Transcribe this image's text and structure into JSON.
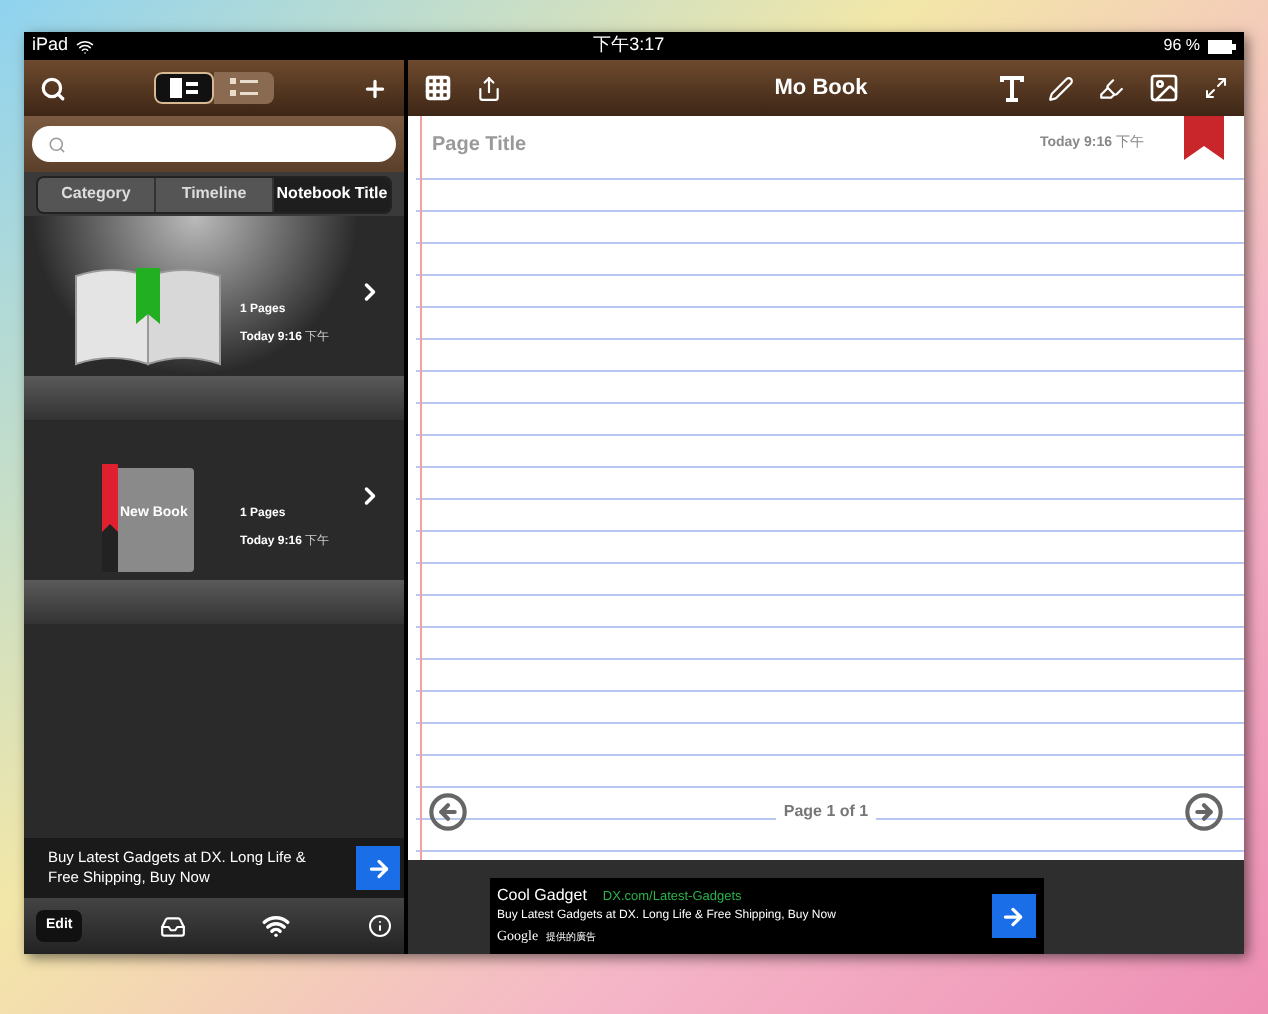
{
  "status_bar": {
    "carrier": "iPad",
    "time": "下午3:17",
    "battery": "96 %"
  },
  "sidebar": {
    "view_toggle": [
      {
        "kind": "shelf",
        "selected": true
      },
      {
        "kind": "list",
        "selected": false
      }
    ],
    "segments": [
      {
        "label": "Category",
        "selected": false
      },
      {
        "label": "Timeline",
        "selected": false
      },
      {
        "label": "Notebook Title",
        "selected": true
      }
    ],
    "books": [
      {
        "kind": "open",
        "color": "#22b022",
        "highlighted": true,
        "pages": "1 Pages",
        "date": "Today 9:16",
        "period": "下午"
      },
      {
        "kind": "closed",
        "color": "#e0202e",
        "highlighted": false,
        "cover_title": "New Book",
        "pages": "1 Pages",
        "date": "Today 9:16",
        "period": "下午"
      }
    ],
    "ad": {
      "text": "Buy Latest Gadgets at DX. Long Life & Free Shipping, Buy Now"
    },
    "toolbar": {
      "edit": "Edit"
    }
  },
  "notebook": {
    "title": "Mo Book",
    "page_title": "Page Title",
    "timestamp": "Today 9:16",
    "period": "下午",
    "page_indicator": "Page 1 of 1",
    "ad": {
      "title": "Cool Gadget",
      "url": "DX.com/Latest-Gadgets",
      "text": "Buy Latest Gadgets at DX. Long Life & Free Shipping, Buy Now",
      "brand": "Google",
      "attribution": "提供的廣告"
    }
  }
}
